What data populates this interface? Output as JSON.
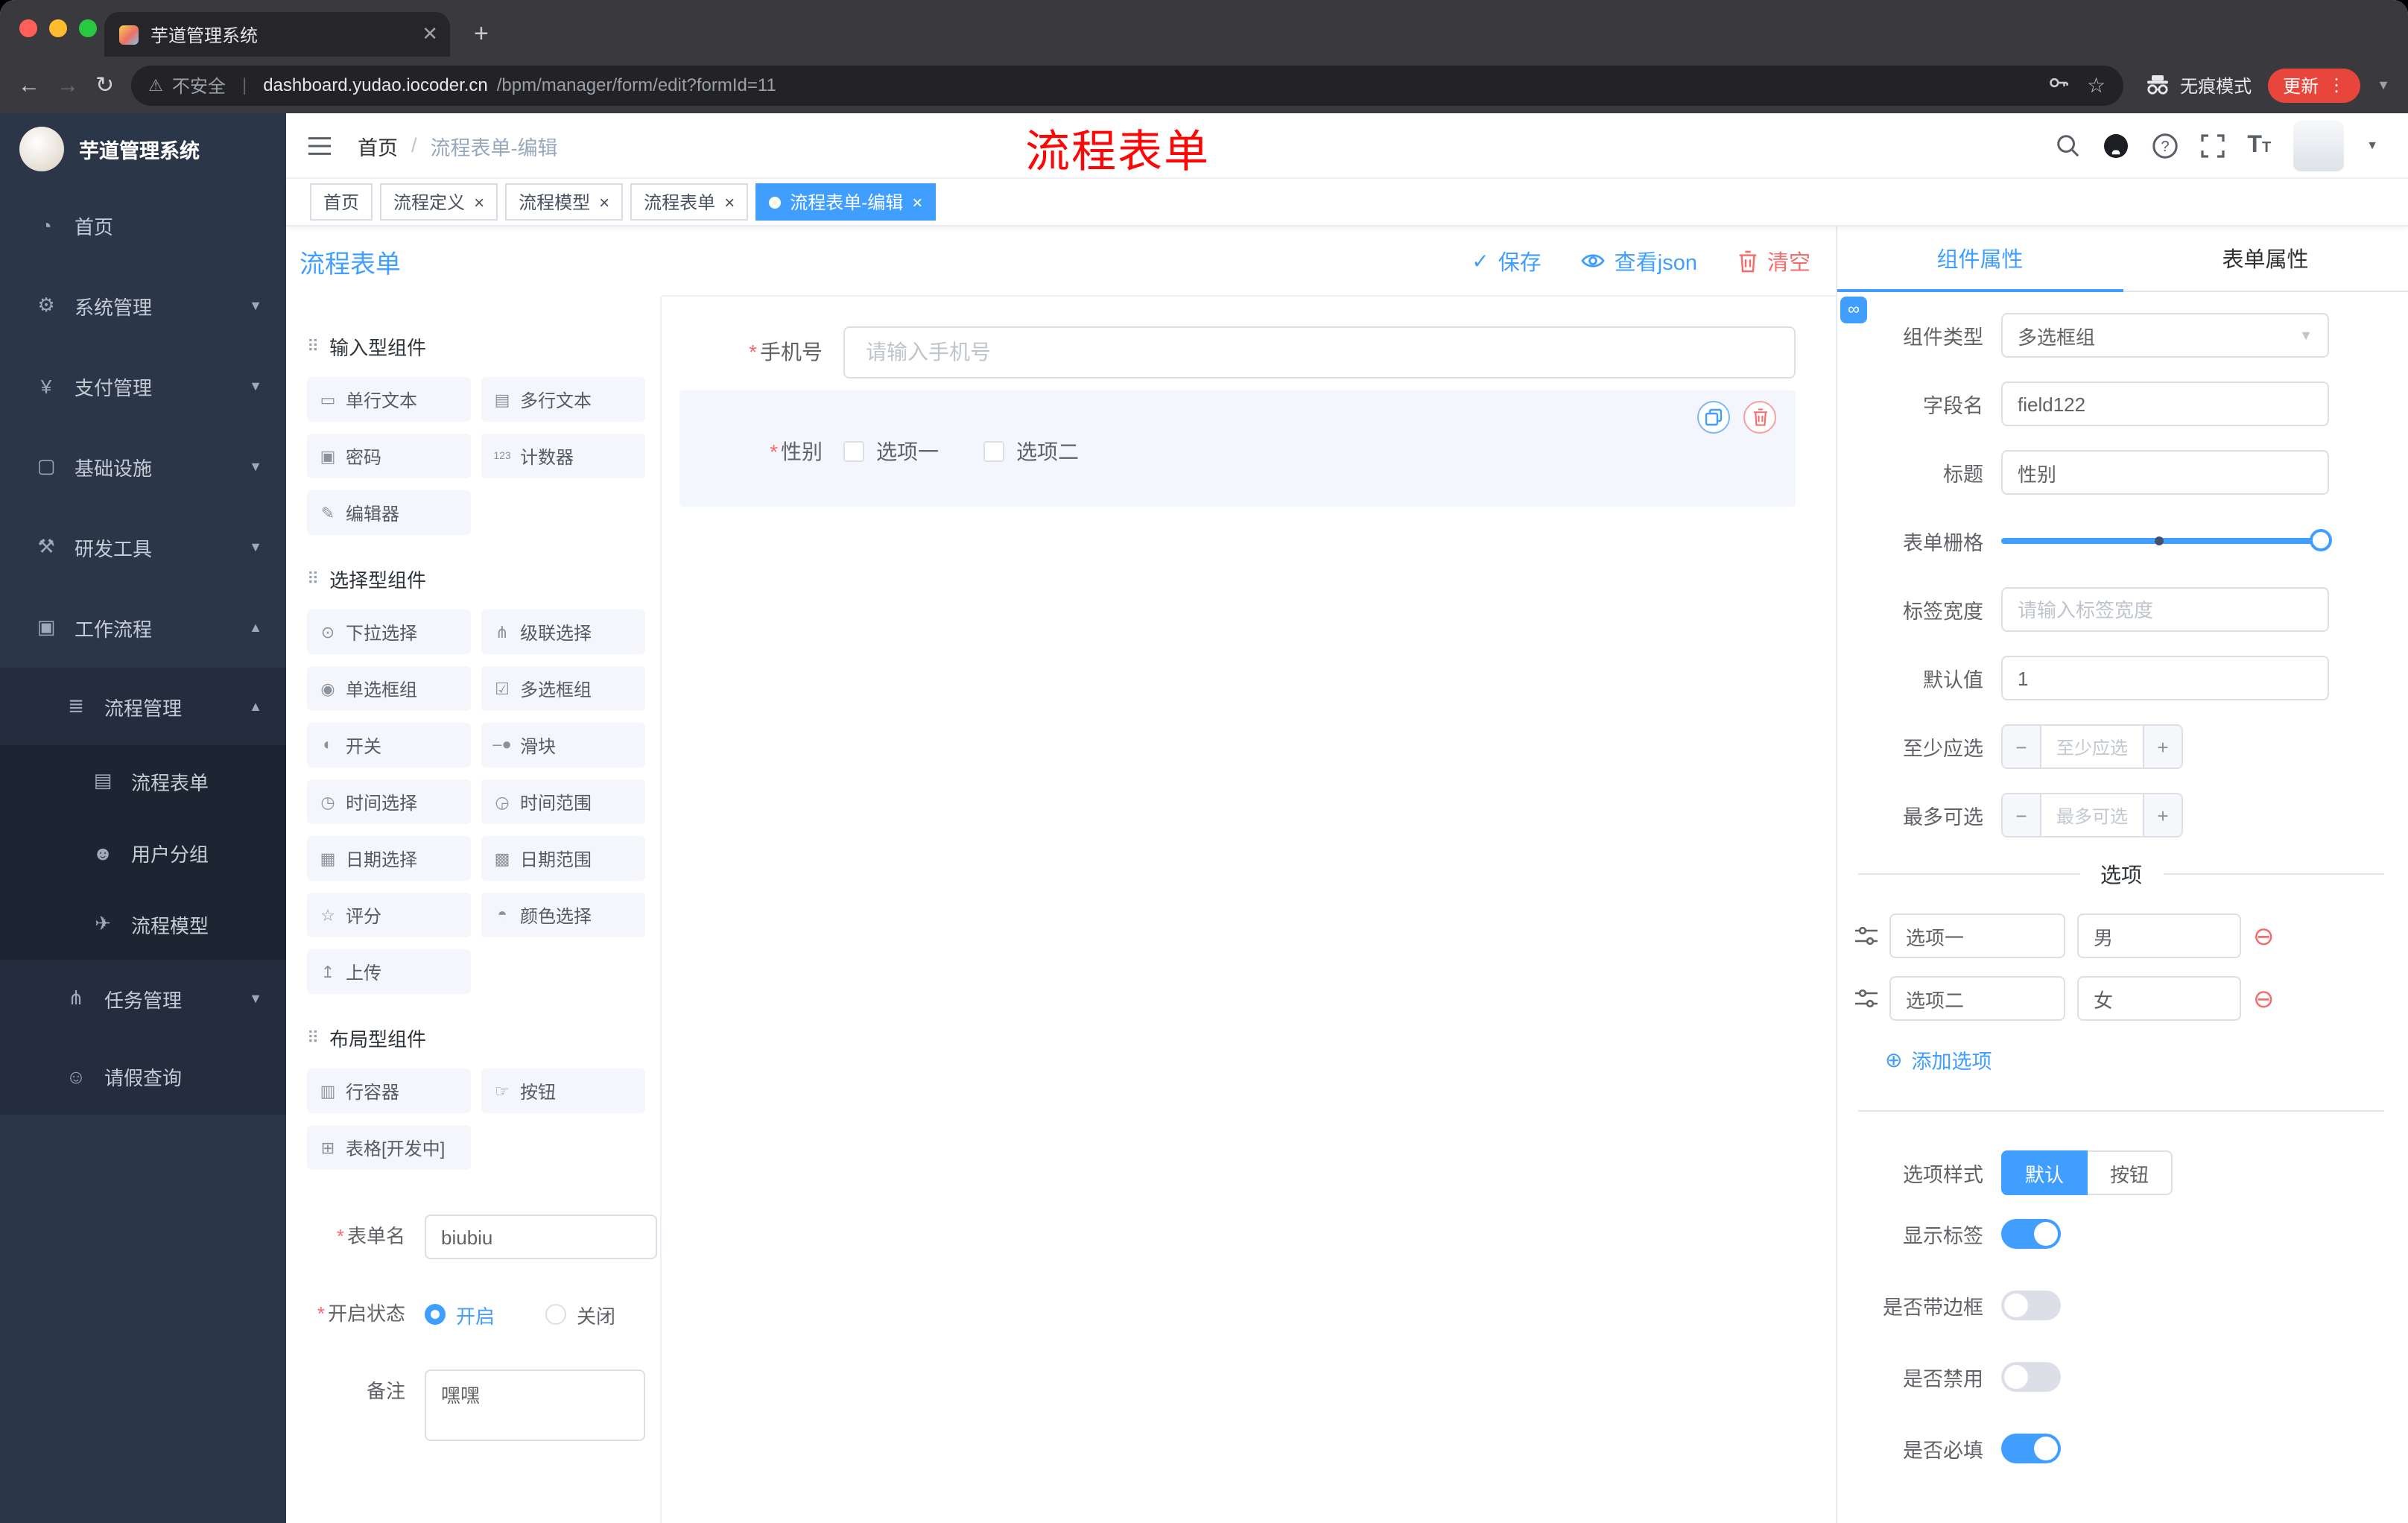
{
  "browser": {
    "tab_title": "芋道管理系统",
    "security_label": "不安全",
    "url_host": "dashboard.yudao.iocoder.cn",
    "url_path": "/bpm/manager/form/edit?formId=11",
    "incognito_label": "无痕模式",
    "update_label": "更新"
  },
  "sidebar": {
    "logo_title": "芋道管理系统",
    "items": [
      {
        "label": "首页",
        "icon": "dashboard-icon"
      },
      {
        "label": "系统管理",
        "icon": "gear-icon"
      },
      {
        "label": "支付管理",
        "icon": "money-icon"
      },
      {
        "label": "基础设施",
        "icon": "monitor-icon"
      },
      {
        "label": "研发工具",
        "icon": "tools-icon"
      },
      {
        "label": "工作流程",
        "icon": "workflow-icon"
      },
      {
        "label": "流程管理",
        "icon": "list-icon"
      },
      {
        "label": "流程表单",
        "icon": "form-icon"
      },
      {
        "label": "用户分组",
        "icon": "users-icon"
      },
      {
        "label": "流程模型",
        "icon": "send-icon"
      },
      {
        "label": "任务管理",
        "icon": "tree-icon"
      },
      {
        "label": "请假查询",
        "icon": "user-icon"
      }
    ]
  },
  "header": {
    "breadcrumb_home": "首页",
    "breadcrumb_sep": "/",
    "breadcrumb_current": "流程表单-编辑",
    "annotation": "流程表单"
  },
  "tags": [
    {
      "label": "首页"
    },
    {
      "label": "流程定义"
    },
    {
      "label": "流程模型"
    },
    {
      "label": "流程表单"
    },
    {
      "label": "流程表单-编辑"
    }
  ],
  "designer": {
    "title": "流程表单",
    "save_label": "保存",
    "view_json_label": "查看json",
    "clear_label": "清空",
    "palette_groups": [
      {
        "title": "输入型组件",
        "items": [
          "单行文本",
          "多行文本",
          "密码",
          "计数器",
          "编辑器"
        ]
      },
      {
        "title": "选择型组件",
        "items": [
          "下拉选择",
          "级联选择",
          "单选框组",
          "多选框组",
          "开关",
          "滑块",
          "时间选择",
          "时间范围",
          "日期选择",
          "日期范围",
          "评分",
          "颜色选择",
          "上传"
        ]
      },
      {
        "title": "布局型组件",
        "items": [
          "行容器",
          "按钮",
          "表格[开发中]"
        ]
      }
    ],
    "canvas": {
      "phone_label": "手机号",
      "phone_placeholder": "请输入手机号",
      "gender_label": "性别",
      "gender_options": [
        "选项一",
        "选项二"
      ]
    },
    "meta": {
      "name_label": "表单名",
      "name_value": "biubiu",
      "status_label": "开启状态",
      "status_on": "开启",
      "status_off": "关闭",
      "remark_label": "备注",
      "remark_value": "嘿嘿"
    }
  },
  "props": {
    "tab_component": "组件属性",
    "tab_form": "表单属性",
    "component_type_label": "组件类型",
    "component_type_value": "多选框组",
    "field_label": "字段名",
    "field_value": "field122",
    "title_label": "标题",
    "title_value": "性别",
    "grid_label": "表单栅格",
    "label_width_label": "标签宽度",
    "label_width_placeholder": "请输入标签宽度",
    "default_label": "默认值",
    "default_value": "1",
    "min_label": "至少应选",
    "min_placeholder": "至少应选",
    "max_label": "最多可选",
    "max_placeholder": "最多可选",
    "options_title": "选项",
    "options": [
      {
        "name": "选项一",
        "value": "男"
      },
      {
        "name": "选项二",
        "value": "女"
      }
    ],
    "add_option_label": "添加选项",
    "style_label": "选项样式",
    "style_default": "默认",
    "style_button": "按钮",
    "switch_rows": [
      {
        "label": "显示标签",
        "on": true
      },
      {
        "label": "是否带边框",
        "on": false
      },
      {
        "label": "是否禁用",
        "on": false
      },
      {
        "label": "是否必填",
        "on": true
      }
    ]
  }
}
